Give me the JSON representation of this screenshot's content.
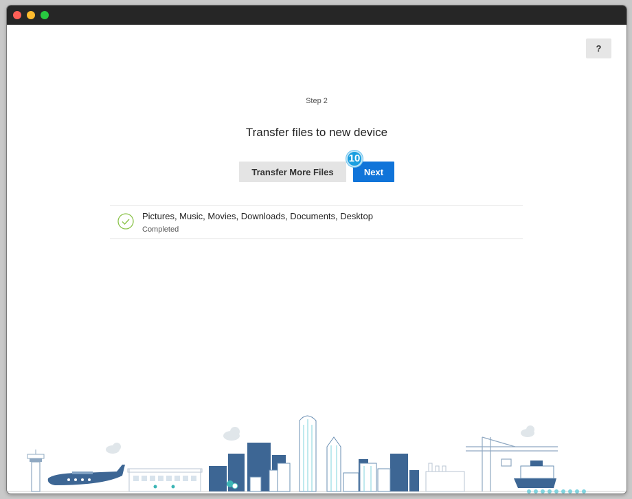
{
  "window": {
    "controls": [
      "close",
      "minimize",
      "maximize"
    ]
  },
  "help": {
    "label": "?"
  },
  "wizard": {
    "step_label": "Step 2",
    "title": "Transfer files to new device",
    "transfer_more_label": "Transfer More Files",
    "next_label": "Next",
    "tour_badge": "10"
  },
  "transfer": {
    "items": [
      {
        "title": "Pictures, Music, Movies, Downloads, Documents, Desktop",
        "status": "Completed",
        "icon": "check-circle-icon"
      }
    ]
  },
  "colors": {
    "primary": "#1074d9",
    "success": "#8bc34a",
    "skyline_dark": "#3d6694",
    "skyline_light": "#7fd3de"
  }
}
